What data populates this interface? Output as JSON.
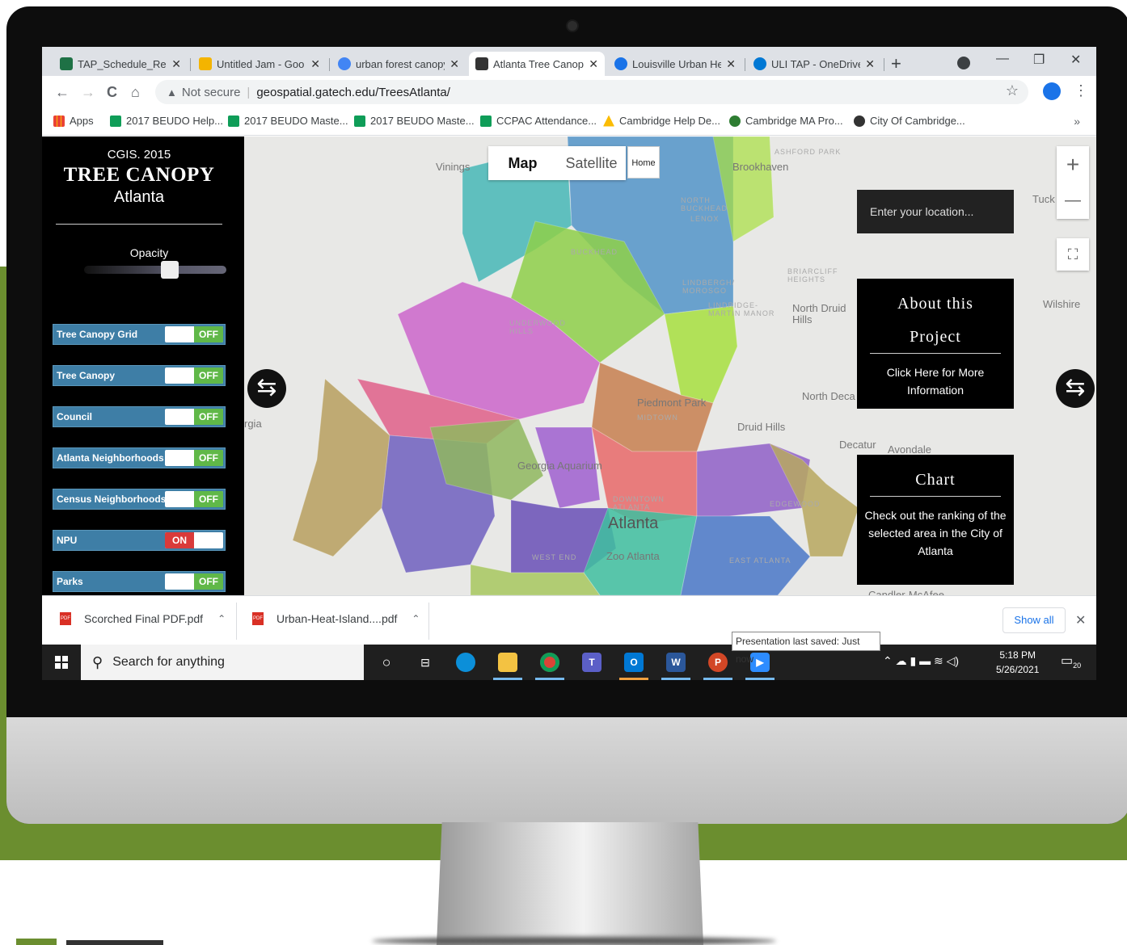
{
  "browser": {
    "tabs": [
      {
        "label": "TAP_Schedule_Reso",
        "close": "✕",
        "icon_color": "#1e7145"
      },
      {
        "label": "Untitled Jam - Goo",
        "close": "✕",
        "icon_color": "#f4b400"
      },
      {
        "label": "urban forest canopy",
        "close": "✕",
        "icon_color": "#4285f4"
      },
      {
        "label": "Atlanta Tree Canopy",
        "close": "✕",
        "icon_color": "#333333"
      },
      {
        "label": "Louisville Urban He",
        "close": "✕",
        "icon_color": "#1a73e8"
      },
      {
        "label": "ULI TAP - OneDrive",
        "close": "✕",
        "icon_color": "#0078d4"
      }
    ],
    "new_tab": "+",
    "window_controls": [
      "—",
      "❐",
      "✕"
    ],
    "nav": {
      "back": "←",
      "forward": "→",
      "reload": "C",
      "home": "⌂"
    },
    "address": {
      "security": "Not secure",
      "url": "geospatial.gatech.edu/TreesAtlanta/"
    },
    "bookmarks": [
      {
        "label": "Apps",
        "icon_color": "#ea4335"
      },
      {
        "label": "2017 BEUDO Help...",
        "icon_color": "#0f9d58"
      },
      {
        "label": "2017 BEUDO Maste...",
        "icon_color": "#0f9d58"
      },
      {
        "label": "2017 BEUDO Maste...",
        "icon_color": "#0f9d58"
      },
      {
        "label": "CCPAC Attendance...",
        "icon_color": "#0f9d58"
      },
      {
        "label": "Cambridge Help De...",
        "icon_color": "#fbbc04"
      },
      {
        "label": "Cambridge MA Pro...",
        "icon_color": "#2e7d32"
      },
      {
        "label": "City Of Cambridge...",
        "icon_color": "#333333"
      }
    ],
    "bookmarks_more": "»"
  },
  "app": {
    "subtitle": "CGIS.  2015",
    "title": "TREE CANOPY",
    "city": "Atlanta",
    "opacity_label": "Opacity",
    "opacity_value": 0.6,
    "layers": [
      {
        "label": "Tree Canopy Grid",
        "state": "OFF"
      },
      {
        "label": "Tree Canopy",
        "state": "OFF"
      },
      {
        "label": "Council",
        "state": "OFF"
      },
      {
        "label": "Atlanta Neighborhoods",
        "state": "OFF"
      },
      {
        "label": "Census Neighborhoods",
        "state": "OFF"
      },
      {
        "label": "NPU",
        "state": "ON"
      },
      {
        "label": "Parks",
        "state": "OFF"
      }
    ]
  },
  "map": {
    "type_options": [
      "Map",
      "Satellite"
    ],
    "selected_type": "Map",
    "home_label": "Home",
    "zoom_in": "+",
    "zoom_out": "—",
    "fullscreen": "⛶",
    "location_placeholder": "Enter your location...",
    "labels": {
      "vinings": "Vinings",
      "brookhaven": "Brookhaven",
      "ashford_park": "ASHFORD PARK",
      "tucker": "Tuck",
      "north_buckhead": "NORTH BUCKHEAD",
      "lenox": "LENOX",
      "buckhead": "BUCKHEAD",
      "lindbergh": "LINDBERGH/ MOROSGO",
      "briarcliff": "BRIARCLIFF HEIGHTS",
      "wilshire": "Wilshire",
      "north_druid_hills": "North Druid Hills",
      "lindridge": "LINDRIDGE-MARTIN MANOR",
      "underwood": "UNDERWOOD HILLS",
      "piedmont_park": "Piedmont Park",
      "midtown": "MIDTOWN",
      "north_decatur": "North Deca",
      "druid_hills": "Druid Hills",
      "decatur": "Decatur",
      "avondale": "Avondale",
      "georgia": "rgia",
      "georgia_aquarium": "Georgia Aquarium",
      "downtown": "DOWNTOWN ATLANTA",
      "atlanta": "Atlanta",
      "edgewood": "EDGEWOOD",
      "zoo_atlanta": "Zoo Atlanta",
      "west_end": "WEST END",
      "east_atlanta": "EAST ATLANTA",
      "candler": "Candler-McAfee"
    },
    "about_panel": {
      "title_line1": "About this",
      "title_line2": "Project",
      "body": "Click Here for More Information"
    },
    "chart_panel": {
      "title": "Chart",
      "body": "Check out the ranking of the selected area in the City of Atlanta"
    }
  },
  "downloads": [
    {
      "label": "Scorched Final PDF.pdf"
    },
    {
      "label": "Urban-Heat-Island....pdf"
    }
  ],
  "show_all": "Show all",
  "tooltip": "Presentation last saved: Just now",
  "taskbar": {
    "search_placeholder": "Search for anything",
    "time": "5:18 PM",
    "date": "5/26/2021",
    "notification_count": "20"
  },
  "colors": {
    "green_accent": "#6b8e2f",
    "layer_blue": "#3e7ea6",
    "toggle_off": "#60b848",
    "toggle_on": "#d93a3a"
  }
}
